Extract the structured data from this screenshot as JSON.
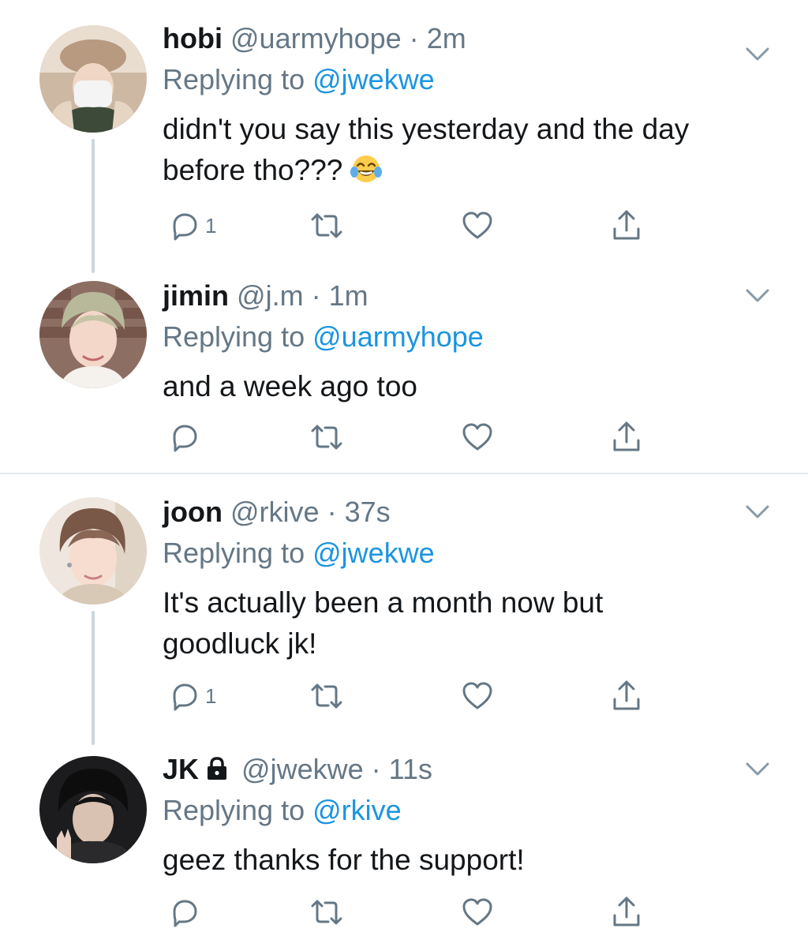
{
  "tweets": [
    {
      "name": "hobi",
      "handle": "@uarmyhope",
      "dot": "·",
      "time": "2m",
      "replying_prefix": "Replying to",
      "replying_to": "@jwekwe",
      "text": "didn't you say this yesterday and the day before tho???",
      "emoji": "face-with-tears-of-joy",
      "reply_count": "1",
      "locked": false
    },
    {
      "name": "jimin",
      "handle": "@j.m",
      "dot": "·",
      "time": "1m",
      "replying_prefix": "Replying to",
      "replying_to": "@uarmyhope",
      "text": "and a week ago too",
      "reply_count": "",
      "locked": false
    },
    {
      "name": "joon",
      "handle": "@rkive",
      "dot": "·",
      "time": "37s",
      "replying_prefix": "Replying to",
      "replying_to": "@jwekwe",
      "text": "It's actually been a month now but goodluck jk!",
      "reply_count": "1",
      "locked": false
    },
    {
      "name": "JK",
      "handle": "@jwekwe",
      "dot": "·",
      "time": "11s",
      "replying_prefix": "Replying to",
      "replying_to": "@rkive",
      "text": "geez thanks for the support!",
      "reply_count": "",
      "locked": true
    }
  ],
  "icons": {
    "reply": "reply-icon",
    "retweet": "retweet-icon",
    "like": "heart-icon",
    "share": "share-icon",
    "more": "chevron-down-icon",
    "lock": "lock-icon"
  },
  "colors": {
    "text": "#14171a",
    "secondary": "#657786",
    "link": "#1b95e0",
    "thread_line": "#ccd6dd",
    "separator": "#e1e8ed"
  }
}
